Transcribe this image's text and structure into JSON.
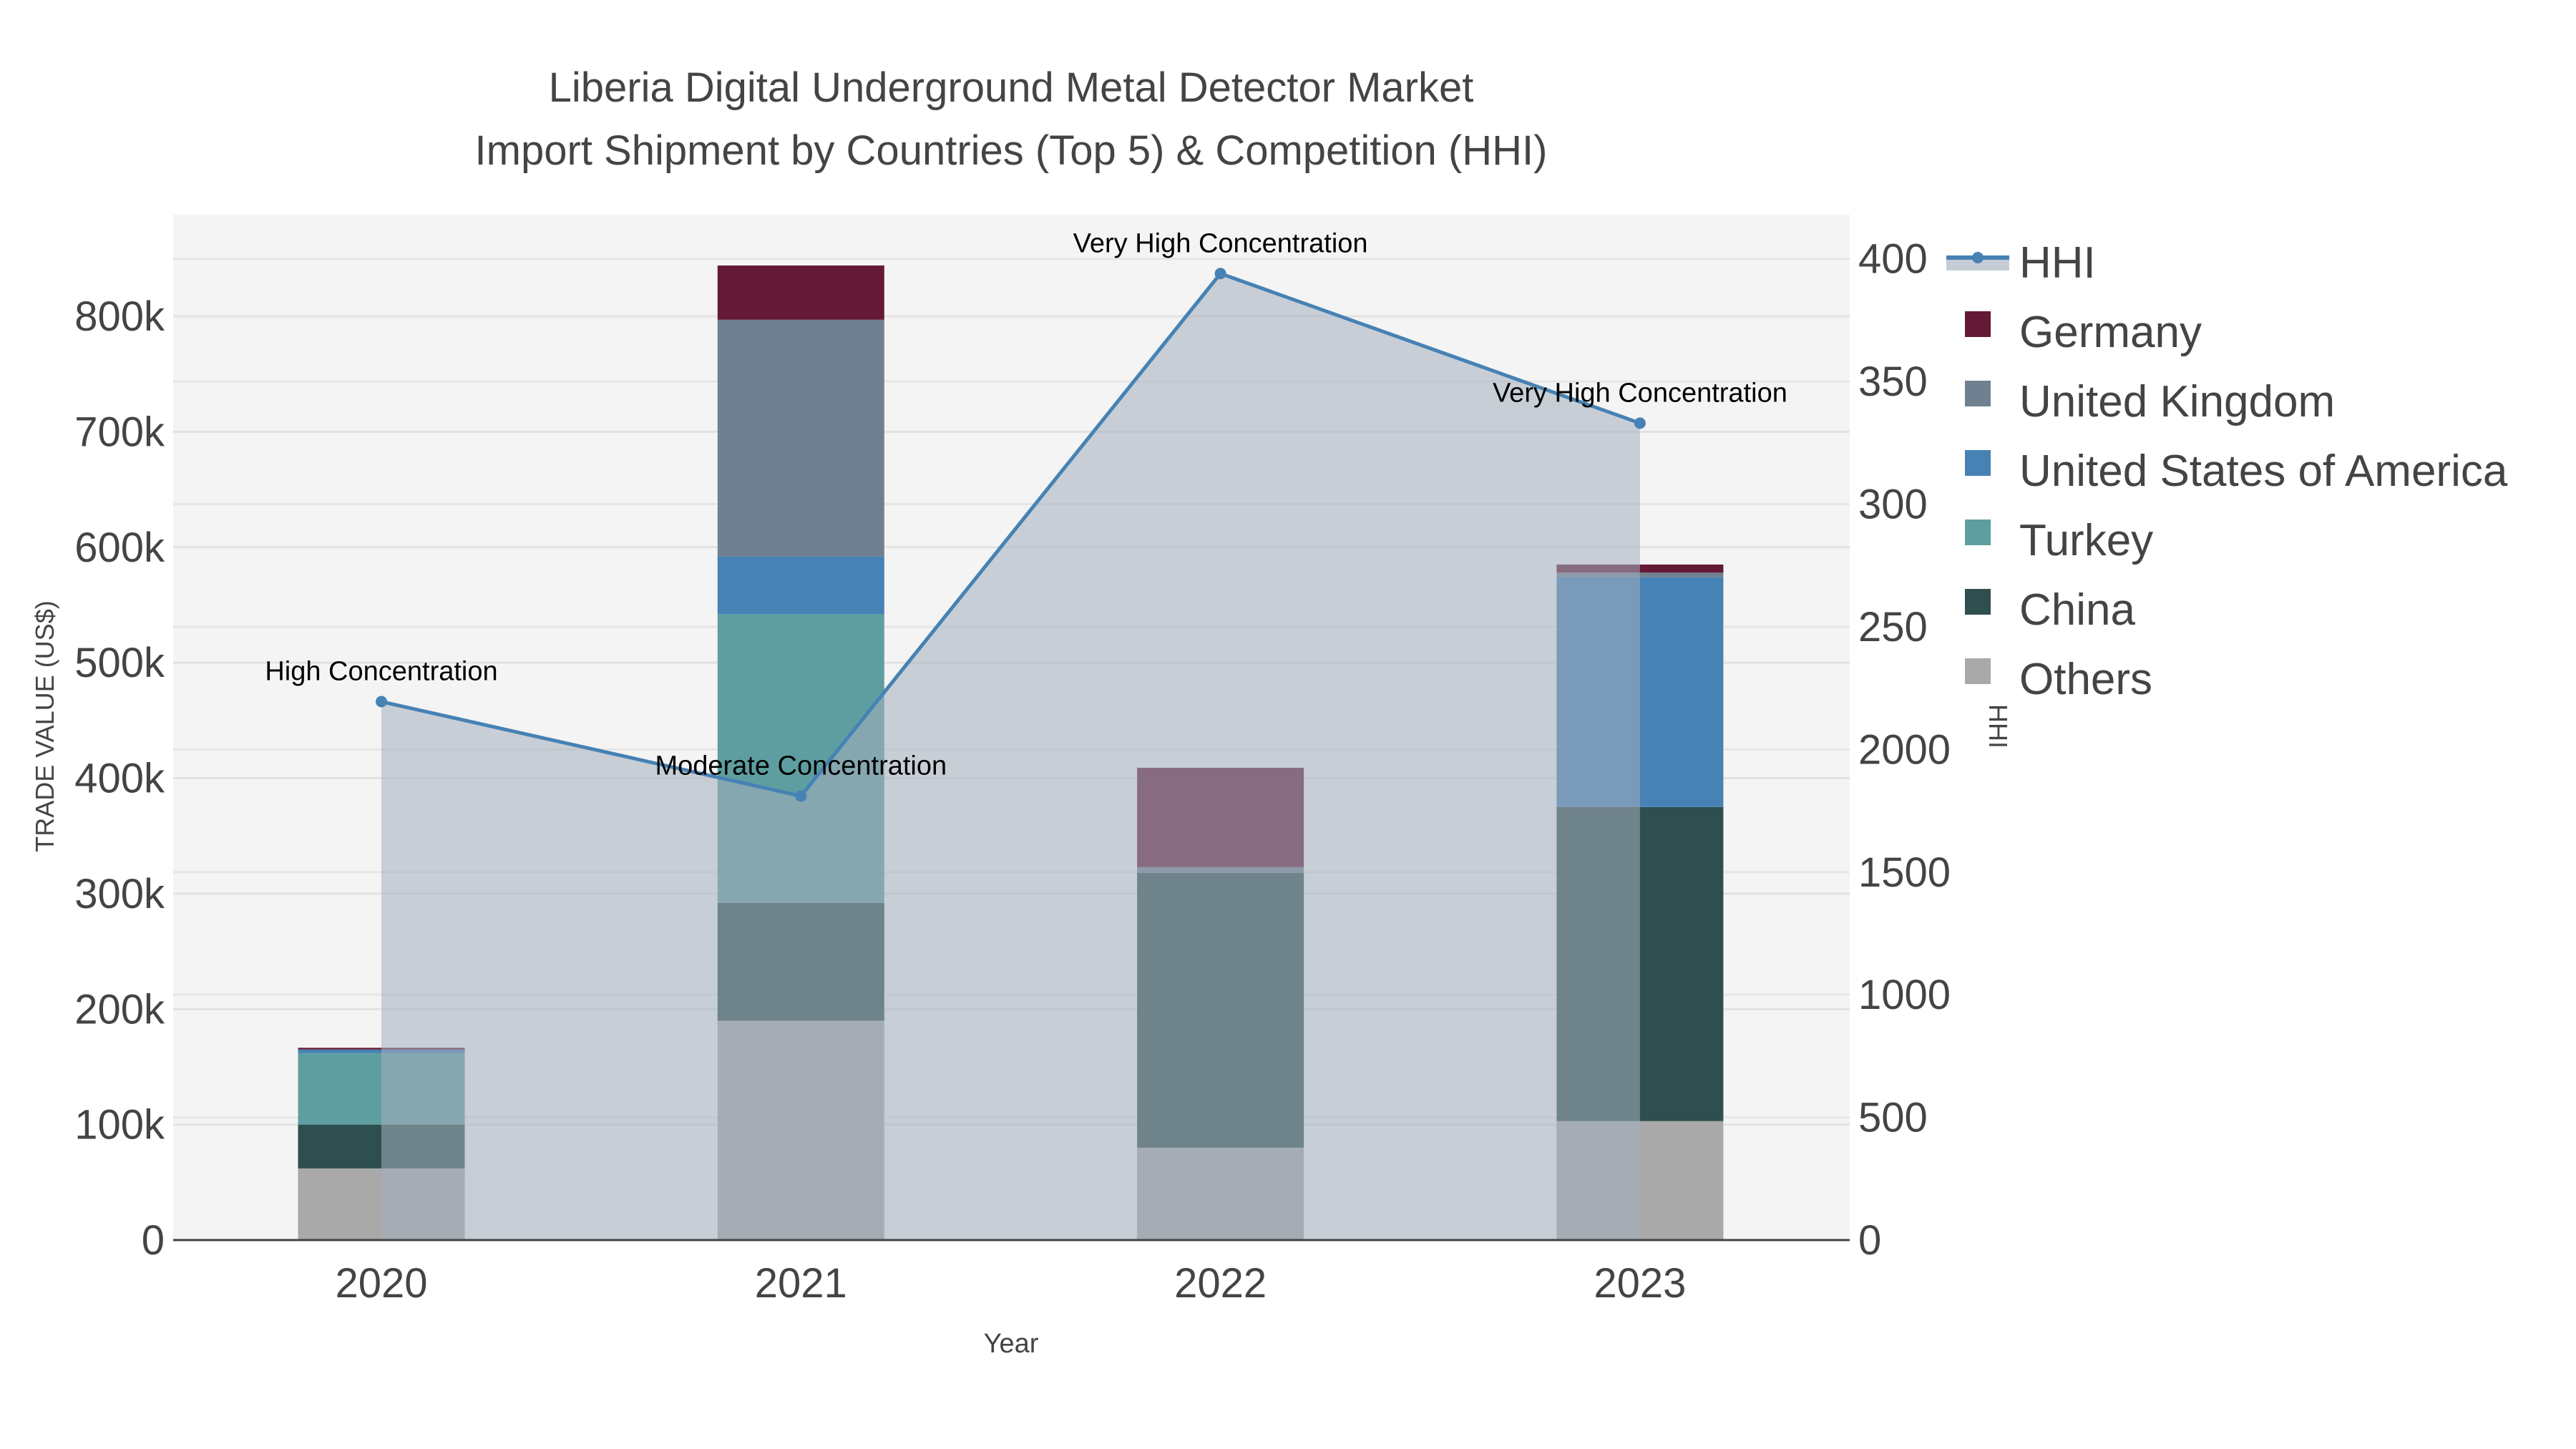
{
  "chart_data": {
    "type": "bar",
    "title_line1": "Liberia Digital Underground Metal Detector Market",
    "title_line2": "Import Shipment by Countries (Top 5) & Competition (HHI)",
    "xlabel": "Year",
    "ylabel": "TRADE VALUE (US$)",
    "y2label": "HHI",
    "categories": [
      "2020",
      "2021",
      "2022",
      "2023"
    ],
    "ylim": [
      0,
      888000
    ],
    "y2lim": [
      0,
      4180
    ],
    "yticks": [
      0,
      100000,
      200000,
      300000,
      400000,
      500000,
      600000,
      700000,
      800000
    ],
    "ytick_labels": [
      "0",
      "100k",
      "200k",
      "300k",
      "400k",
      "500k",
      "600k",
      "700k",
      "800k"
    ],
    "y2ticks": [
      0,
      500,
      1000,
      1500,
      2000,
      2500,
      3000,
      3500,
      4000
    ],
    "y2tick_labels": [
      "0",
      "500",
      "1000",
      "1500",
      "2000",
      "250",
      "300",
      "350",
      "400"
    ],
    "series": [
      {
        "name": "Others",
        "color": "#a9a9a9",
        "values": [
          62000,
          190000,
          80000,
          103000
        ]
      },
      {
        "name": "China",
        "color": "#2f4f4f",
        "values": [
          38000,
          102000,
          238000,
          272000
        ]
      },
      {
        "name": "Turkey",
        "color": "#5f9ea0",
        "values": [
          62000,
          250000,
          0,
          0
        ]
      },
      {
        "name": "United States of America",
        "color": "#4682b4",
        "values": [
          3000,
          50000,
          0,
          199000
        ]
      },
      {
        "name": "United Kingdom",
        "color": "#708090",
        "values": [
          0,
          205000,
          5000,
          4000
        ]
      },
      {
        "name": "Germany",
        "color": "#641a36",
        "values": [
          1500,
          47000,
          86000,
          7000
        ]
      }
    ],
    "line": {
      "name": "HHI",
      "color": "#4682b4",
      "values": [
        2195,
        1810,
        3940,
        3330
      ],
      "annotations": [
        "High Concentration",
        "Moderate Concentration",
        "Very High Concentration",
        "Very High Concentration"
      ]
    },
    "legend": [
      "HHI",
      "Germany",
      "United Kingdom",
      "United States of America",
      "Turkey",
      "China",
      "Others"
    ],
    "legend_position": "right",
    "grid": true
  }
}
